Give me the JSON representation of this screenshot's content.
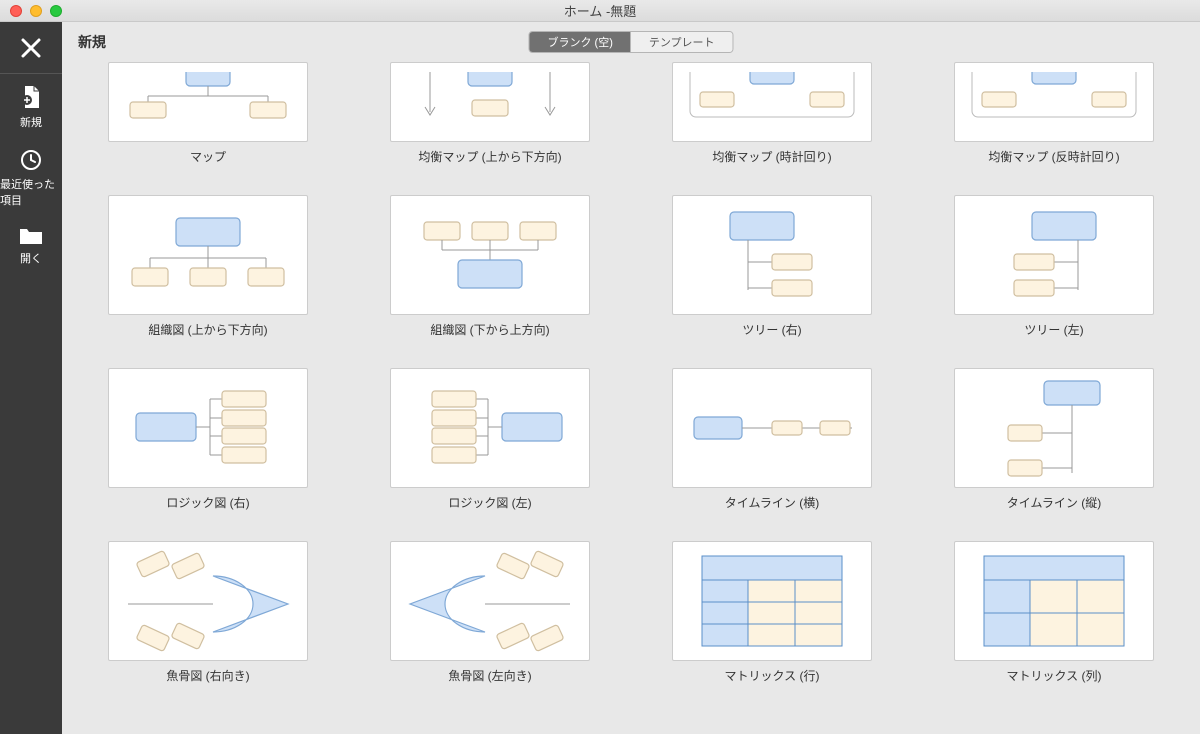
{
  "window": {
    "title": "ホーム -無題"
  },
  "header": {
    "title": "新規",
    "seg_blank": "ブランク (空)",
    "seg_template": "テンプレート"
  },
  "sidebar": {
    "new": "新規",
    "recent": "最近使った項目",
    "open": "開く"
  },
  "templates": [
    {
      "id": "map",
      "label": "マップ"
    },
    {
      "id": "balanced-map-td",
      "label": "均衡マップ (上から下方向)"
    },
    {
      "id": "balanced-map-cw",
      "label": "均衡マップ (時計回り)"
    },
    {
      "id": "balanced-map-ccw",
      "label": "均衡マップ (反時計回り)"
    },
    {
      "id": "org-td",
      "label": "組織図 (上から下方向)"
    },
    {
      "id": "org-bu",
      "label": "組織図 (下から上方向)"
    },
    {
      "id": "tree-right",
      "label": "ツリー (右)"
    },
    {
      "id": "tree-left",
      "label": "ツリー (左)"
    },
    {
      "id": "logic-right",
      "label": "ロジック図 (右)"
    },
    {
      "id": "logic-left",
      "label": "ロジック図 (左)"
    },
    {
      "id": "timeline-h",
      "label": "タイムライン (横)"
    },
    {
      "id": "timeline-v",
      "label": "タイムライン (縦)"
    },
    {
      "id": "fishbone-right",
      "label": "魚骨図 (右向き)"
    },
    {
      "id": "fishbone-left",
      "label": "魚骨図 (左向き)"
    },
    {
      "id": "matrix-row",
      "label": "マトリックス (行)"
    },
    {
      "id": "matrix-col",
      "label": "マトリックス (列)"
    }
  ]
}
